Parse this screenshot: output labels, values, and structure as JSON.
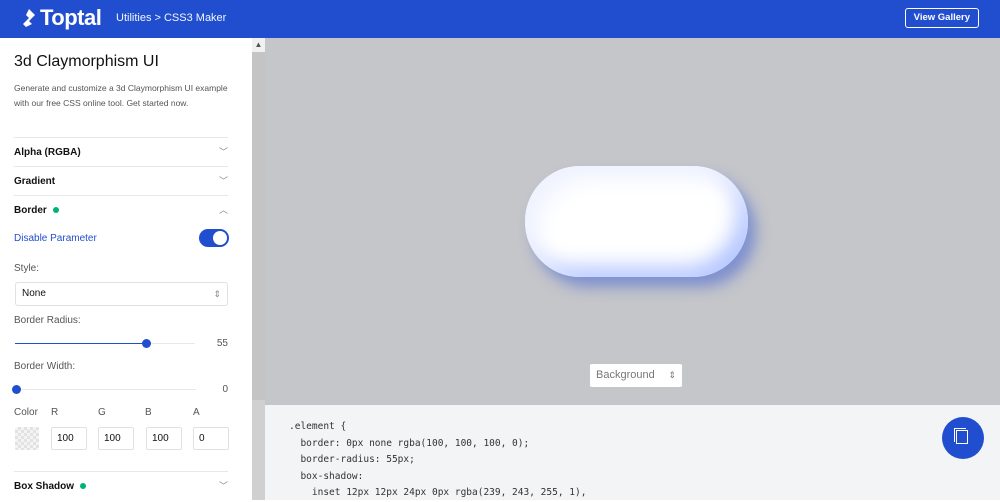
{
  "header": {
    "logo": "Toptal",
    "breadcrumb": "Utilities > CSS3 Maker",
    "view_gallery": "View Gallery"
  },
  "sidebar": {
    "title": "3d Claymorphism UI",
    "description": "Generate and customize a 3d Claymorphism UI example with our free CSS online tool. Get started now.",
    "sections": [
      {
        "label": "Alpha (RGBA)"
      },
      {
        "label": "Gradient"
      },
      {
        "label": "Border"
      },
      {
        "label": "Box Shadow"
      }
    ],
    "border": {
      "disable_label": "Disable Parameter",
      "disable_on": true,
      "style_label": "Style:",
      "style_value": "None",
      "radius_label": "Border Radius:",
      "radius_value": "55",
      "radius_fraction": 0.73,
      "width_label": "Border Width:",
      "width_value": "0",
      "width_fraction": 0,
      "color_label": "Color",
      "r_label": "R",
      "g_label": "G",
      "b_label": "B",
      "a_label": "A",
      "r": "100",
      "g": "100",
      "b": "100",
      "a": "0"
    }
  },
  "preview": {
    "background_select": "Background"
  },
  "code": {
    "lines": [
      ".element {",
      "  border: 0px none rgba(100, 100, 100, 0);",
      "  border-radius: 55px;",
      "  box-shadow:",
      "    inset 12px 12px 24px 0px rgba(239, 243, 255, 1),"
    ]
  },
  "colors": {
    "brand": "#204ecf",
    "active_dot": "#00b27a",
    "preview_bg": "#c5c6ca"
  }
}
